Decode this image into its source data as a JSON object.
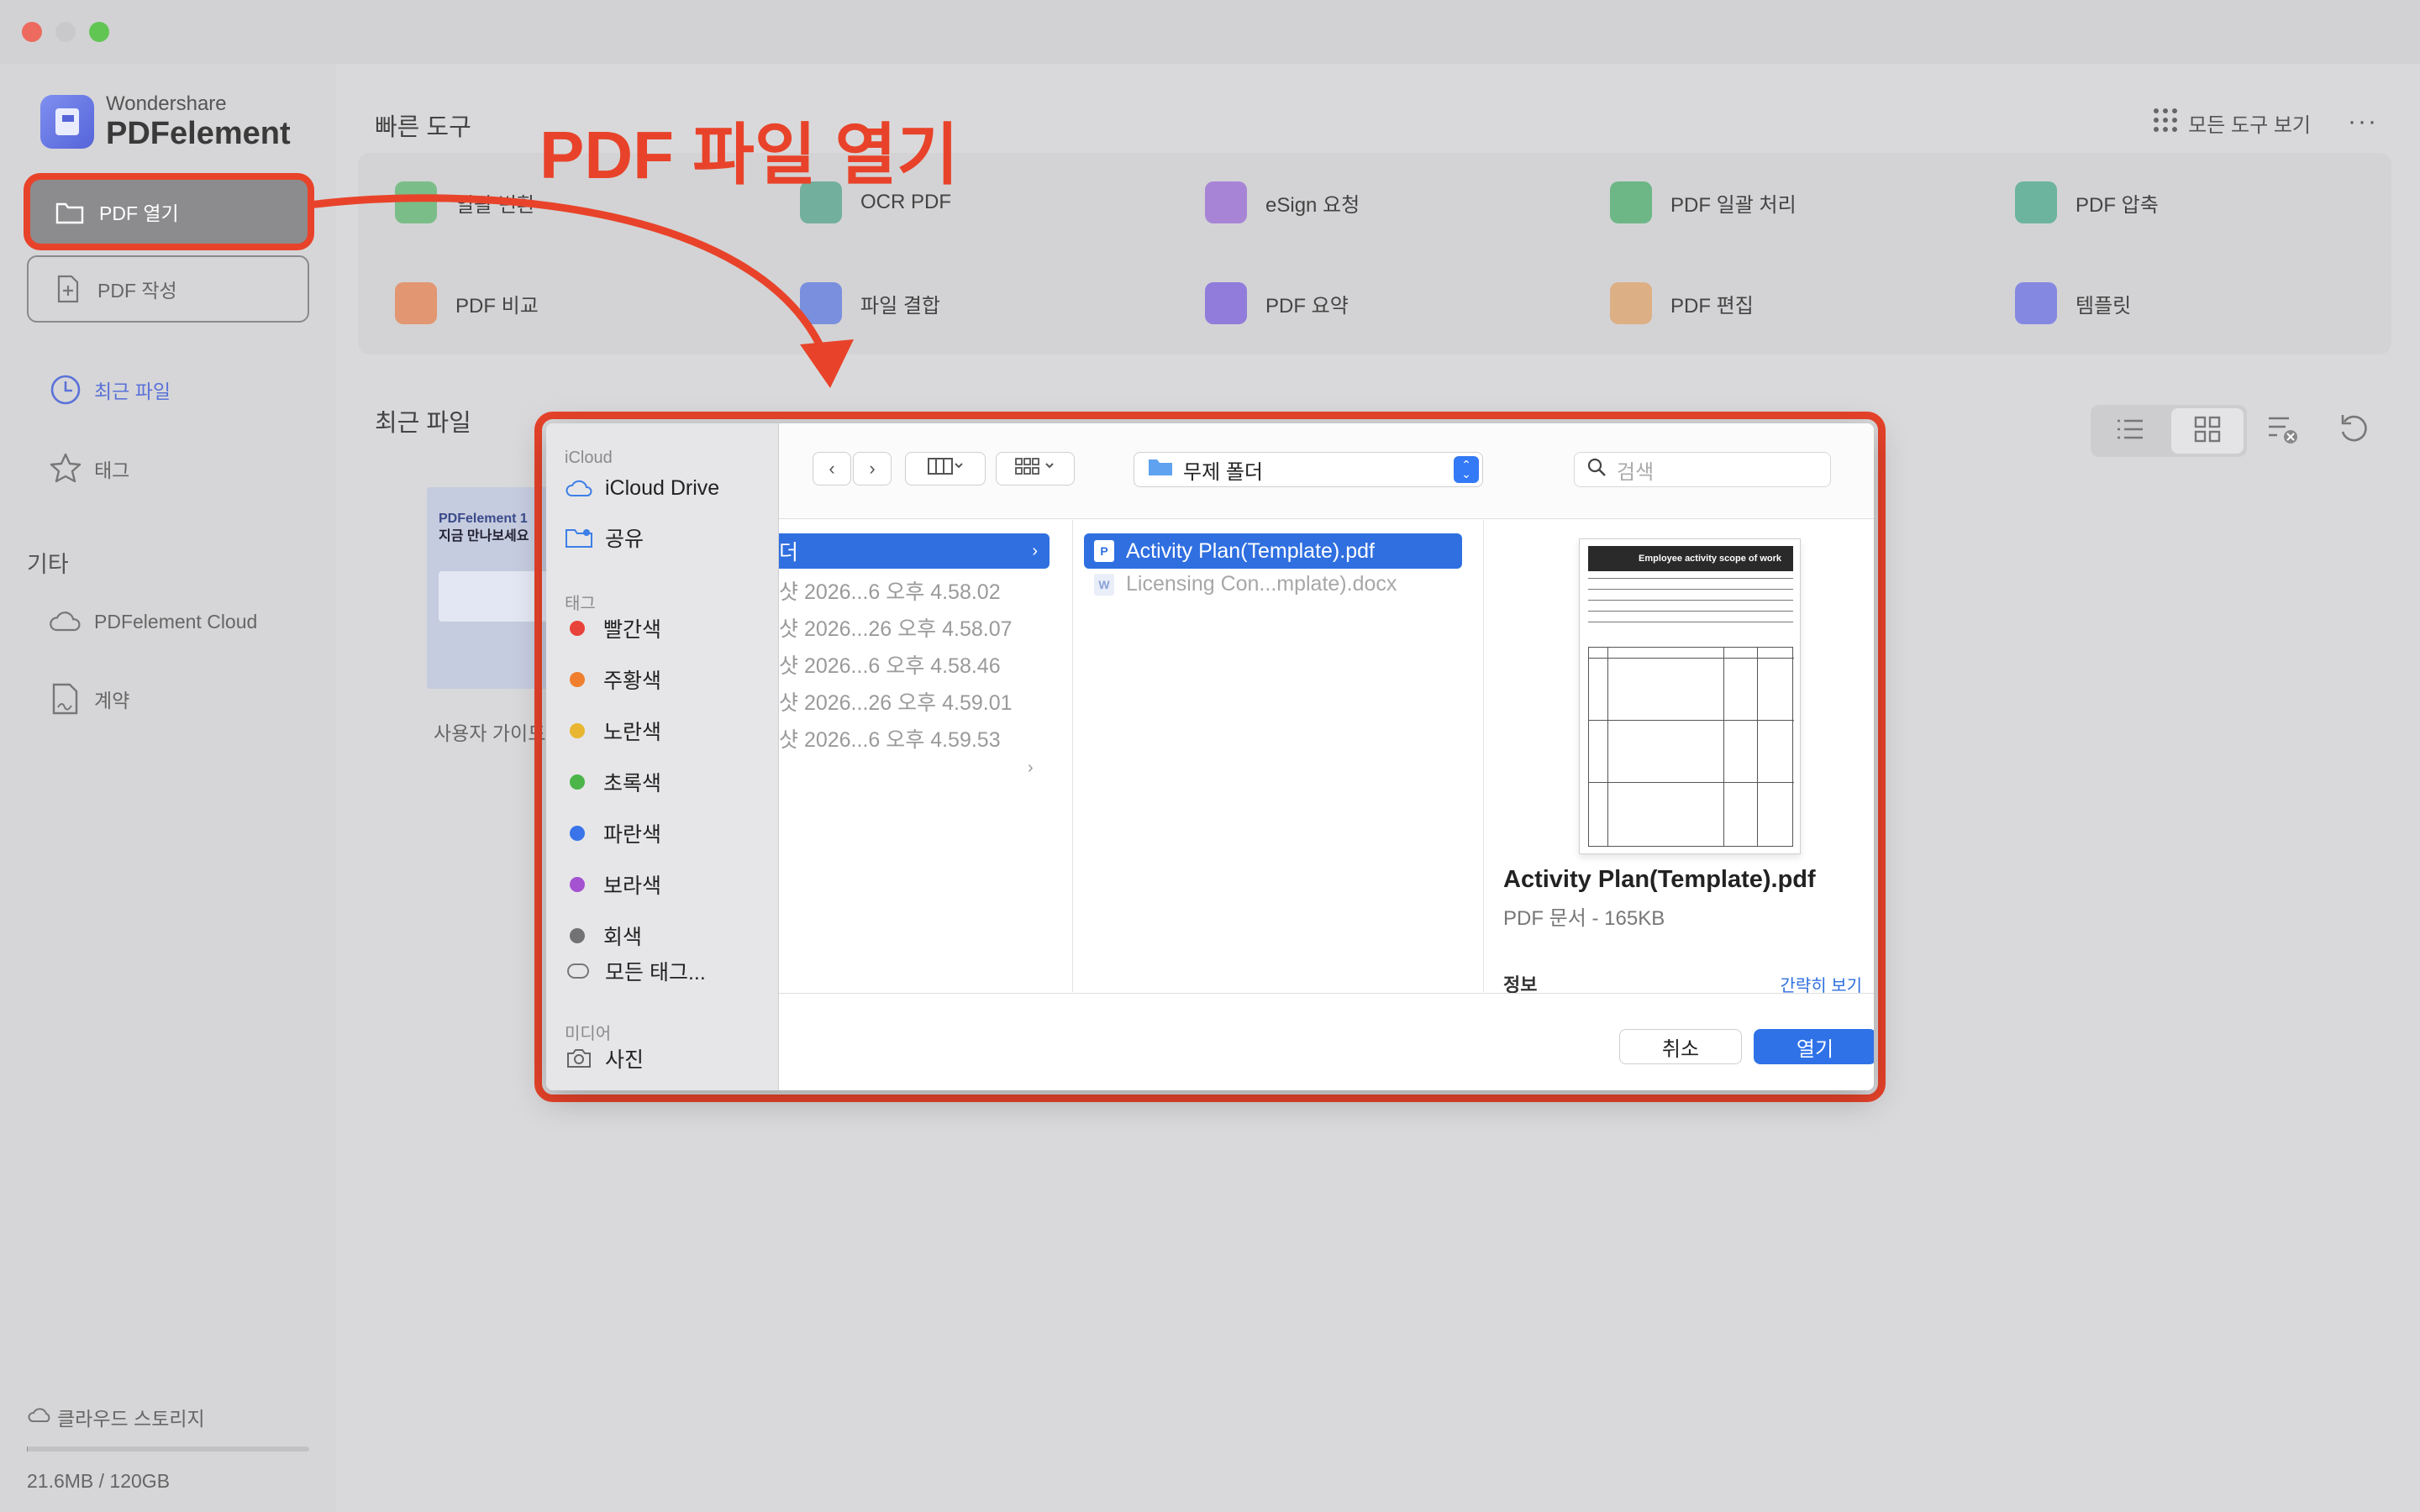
{
  "app": {
    "brand": "Wondershare",
    "name": "PDFelement"
  },
  "sidebar": {
    "open_pdf": "PDF 열기",
    "create_pdf": "PDF 작성",
    "recent": "최근 파일",
    "tags": "태그",
    "etc_section": "기타",
    "cloud": "PDFelement Cloud",
    "contract": "계약",
    "storage_label": "클라우드 스토리지",
    "storage_value": "21.6MB / 120GB",
    "storage_used_fraction": 0.0002
  },
  "main": {
    "quick_tools_title": "빠른 도구",
    "all_tools": "모든 도구 보기",
    "more": "···",
    "recent_title": "최근 파일",
    "tools": [
      {
        "label": "일괄 변환",
        "color": "#5db56e"
      },
      {
        "label": "OCR PDF",
        "color": "#53a38a"
      },
      {
        "label": "eSign 요청",
        "color": "#9a6ad6"
      },
      {
        "label": "PDF 일괄 처리",
        "color": "#4bae6b"
      },
      {
        "label": "PDF 압축",
        "color": "#4aa98a"
      },
      {
        "label": "PDF 비교",
        "color": "#e7824f"
      },
      {
        "label": "파일 결합",
        "color": "#5c7ae0"
      },
      {
        "label": "PDF 요약",
        "color": "#7b5fdc"
      },
      {
        "label": "PDF 편집",
        "color": "#e0a36a"
      },
      {
        "label": "템플릿",
        "color": "#6a6fe4"
      }
    ],
    "recent_file": {
      "name": "사용자 가이드",
      "thumb_line1": "PDFelement 1",
      "thumb_line2": "지금 만나보세요"
    }
  },
  "annotation": {
    "title": "PDF 파일 열기",
    "color": "#e8432a"
  },
  "dialog": {
    "sidebar": {
      "icloud_section": "iCloud",
      "icloud_drive": "iCloud Drive",
      "shared": "공유",
      "tags_section": "태그",
      "tags": [
        {
          "label": "빨간색",
          "color": "#e8433a"
        },
        {
          "label": "주황색",
          "color": "#ef7f2e"
        },
        {
          "label": "노란색",
          "color": "#e8b630"
        },
        {
          "label": "초록색",
          "color": "#4bb54a"
        },
        {
          "label": "파란색",
          "color": "#3a74e8"
        },
        {
          "label": "보라색",
          "color": "#a452d0"
        },
        {
          "label": "회색",
          "color": "#727274"
        }
      ],
      "all_tags": "모든 태그...",
      "media_section": "미디어",
      "photos": "사진"
    },
    "folder": "무제 폴더",
    "search_placeholder": "검색",
    "column1": {
      "selected": "더",
      "rows": [
        "샷 2026...6 오후 4.58.02",
        "샷 2026...26 오후 4.58.07",
        "샷 2026...6 오후 4.58.46",
        "샷 2026...26 오후 4.59.01",
        "샷 2026...6 오후 4.59.53"
      ]
    },
    "column2": {
      "selected": "Activity Plan(Template).pdf",
      "other": "Licensing Con...mplate).docx"
    },
    "preview": {
      "thumb_header": "Employee activity scope of work",
      "file_name": "Activity Plan(Template).pdf",
      "meta": "PDF 문서 - 165KB",
      "info": "정보",
      "show_less": "간략히 보기"
    },
    "cancel": "취소",
    "open": "열기"
  }
}
